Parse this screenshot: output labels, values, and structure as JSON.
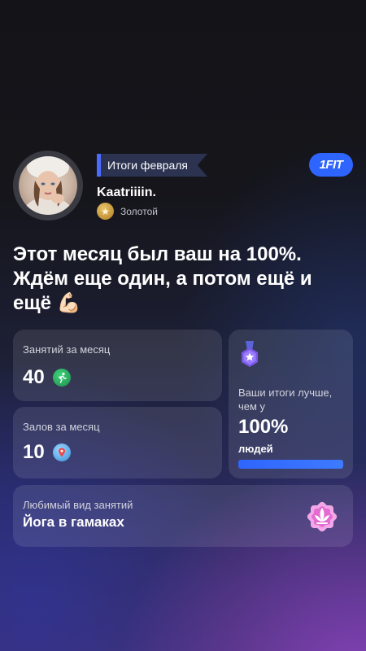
{
  "header": {
    "ribbon_label": "Итоги февраля",
    "brand_logo": "1FIT",
    "username": "Kaatriiiin.",
    "tier_icon": "star-icon",
    "tier_label": "Золотой"
  },
  "headline": {
    "text": "Этот месяц был ваш на 100%. Ждём еще один, а потом ещё и ещё 💪🏻"
  },
  "stats": {
    "sessions": {
      "label": "Занятий за месяц",
      "value": "40",
      "icon": "running-icon"
    },
    "gyms": {
      "label": "Залов за месяц",
      "value": "10",
      "icon": "location-pin-icon"
    }
  },
  "comparison": {
    "text": "Ваши итоги лучше, чем у",
    "value": "100%",
    "suffix": "людей",
    "progress": 1.0,
    "accent": "#2f65ff"
  },
  "favorite": {
    "label": "Любимый вид занятий",
    "value": "Йога в гамаках",
    "icon": "lotus-icon"
  }
}
